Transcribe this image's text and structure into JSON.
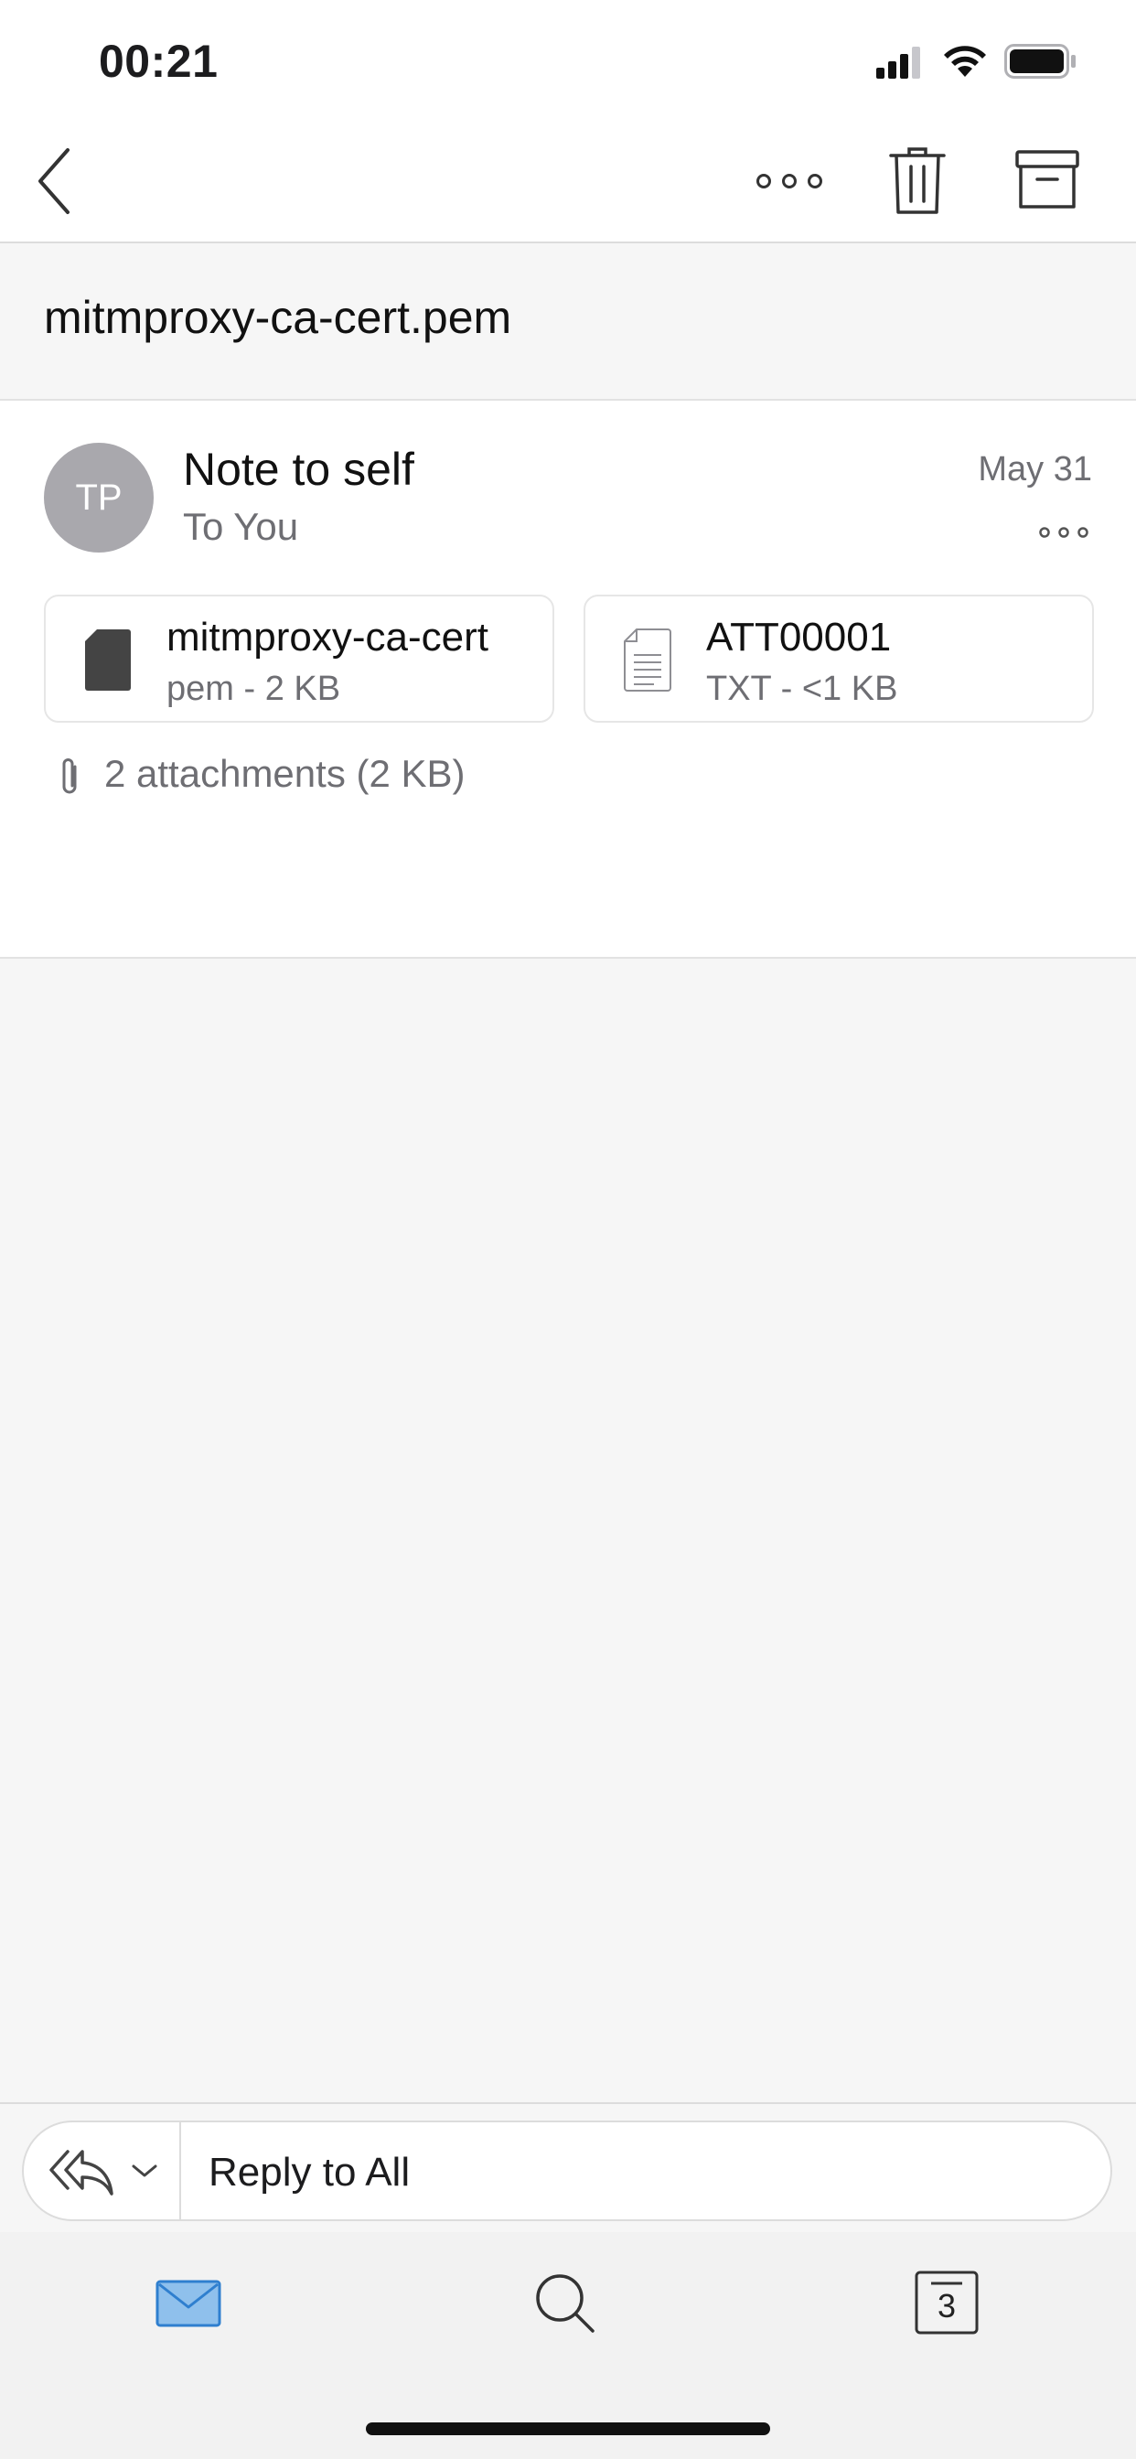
{
  "status_bar": {
    "time": "00:21"
  },
  "nav": {
    "back_icon": "chevron-left-icon",
    "more_icon": "more-horizontal-icon",
    "delete_icon": "trash-icon",
    "archive_icon": "archive-icon"
  },
  "message": {
    "subject": "mitmproxy-ca-cert.pem",
    "avatar_initials": "TP",
    "sender": "Note to self",
    "recipients": "To You",
    "date": "May 31",
    "attachments": [
      {
        "name": "mitmproxy-ca-cert",
        "meta": "pem - 2 KB",
        "icon": "file-filled-icon"
      },
      {
        "name": "ATT00001",
        "meta": "TXT - <1 KB",
        "icon": "text-document-icon"
      }
    ],
    "attachment_summary": "2 attachments (2 KB)"
  },
  "reply_bar": {
    "label": "Reply to All"
  },
  "tab_bar": {
    "mail_icon": "mail-icon",
    "search_icon": "search-icon",
    "calendar_icon": "calendar-icon",
    "calendar_day": "3"
  },
  "colors": {
    "accent": "#2f7fcf",
    "avatar_bg": "#a9a8ad",
    "secondary_text": "#6e6e73"
  }
}
